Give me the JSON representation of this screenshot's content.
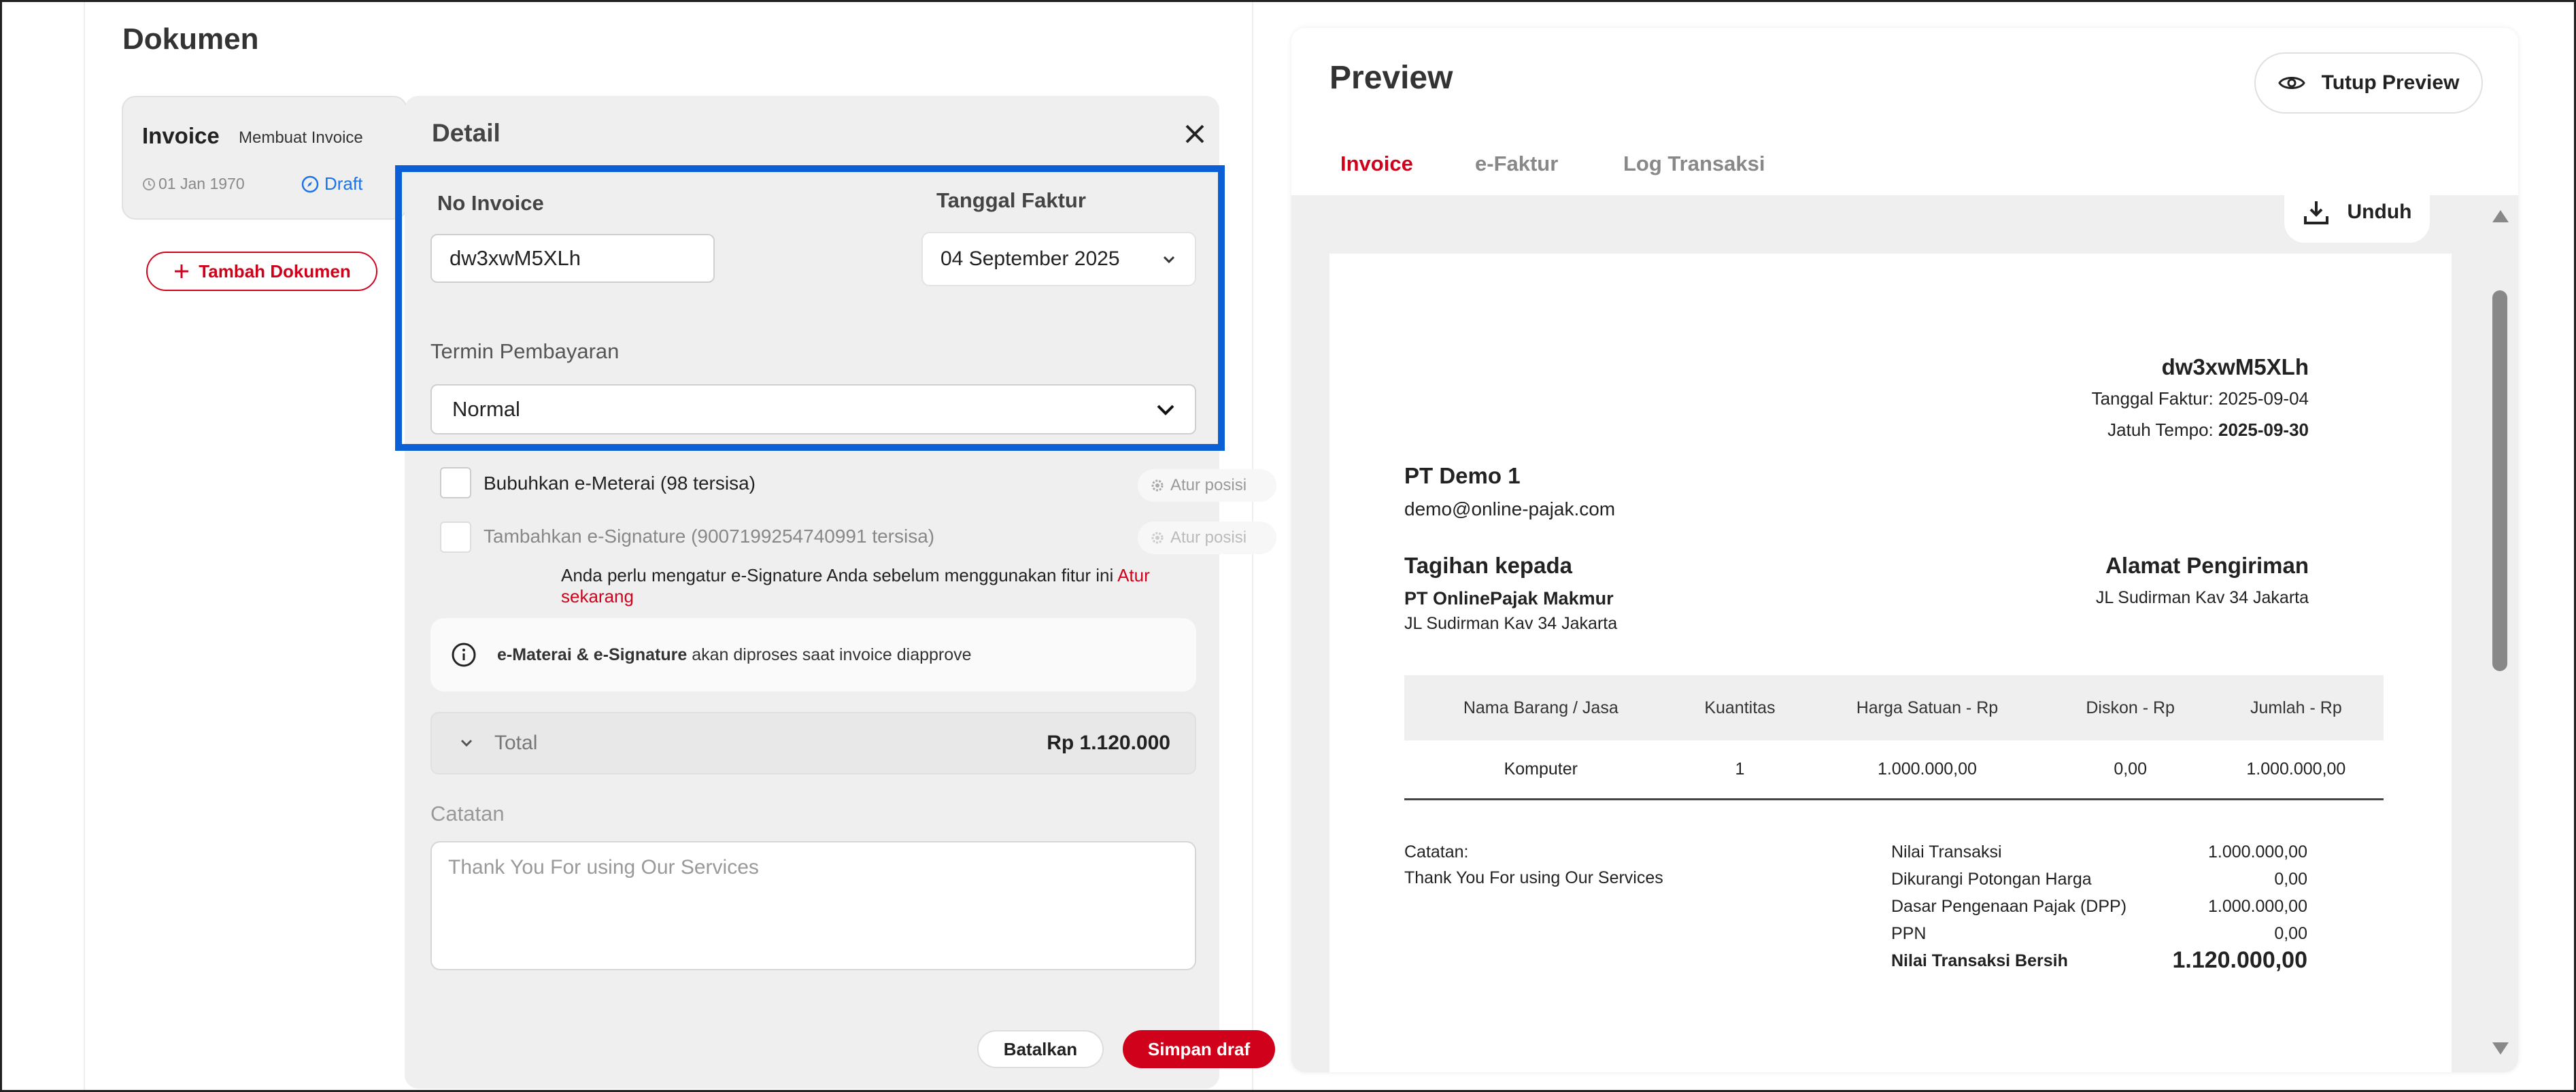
{
  "left": {
    "title": "Dokumen",
    "card": {
      "title": "Invoice",
      "subtitle": "Membuat Invoice",
      "date": "01 Jan 1970",
      "status": "Draft"
    },
    "add_button": "Tambah Dokumen"
  },
  "detail": {
    "title": "Detail",
    "no_invoice_label": "No Invoice",
    "no_invoice_value": "dw3xwM5XLh",
    "tanggal_label": "Tanggal Faktur",
    "tanggal_value": "04 September 2025",
    "termin_label": "Termin Pembayaran",
    "termin_value": "Normal",
    "meterai_label": "Bubuhkan e-Meterai (98 tersisa)",
    "sign_label": "Tambahkan e-Signature (9007199254740991 tersisa)",
    "atur_posisi": "Atur posisi",
    "sign_note": "Anda perlu mengatur e-Signature Anda sebelum menggunakan fitur ini",
    "sign_note_link": "Atur sekarang",
    "info_bold": "e-Materai & e-Signature",
    "info_rest": "akan diproses saat invoice diapprove",
    "total_label": "Total",
    "total_value": "Rp 1.120.000",
    "catatan_label": "Catatan",
    "catatan_value": "Thank You For using Our Services",
    "cancel_button": "Batalkan",
    "save_button": "Simpan draf"
  },
  "preview": {
    "title": "Preview",
    "close_button": "Tutup Preview",
    "tabs": [
      "Invoice",
      "e-Faktur",
      "Log Transaksi"
    ],
    "active_tab": "Invoice",
    "download_button": "Unduh",
    "invoice": {
      "number": "dw3xwM5XLh",
      "tanggal": "Tanggal Faktur: 2025-09-04",
      "jatuh_tempo_label": "Jatuh Tempo:",
      "jatuh_tempo_value": "2025-09-30",
      "from_name": "PT Demo 1",
      "from_email": "demo@online-pajak.com",
      "bill_heading": "Tagihan kepada",
      "bill_name": "PT OnlinePajak Makmur",
      "bill_address": "JL Sudirman Kav 34 Jakarta",
      "ship_heading": "Alamat Pengiriman",
      "ship_address": "JL Sudirman Kav 34 Jakarta",
      "table": {
        "headers": [
          "Nama Barang / Jasa",
          "Kuantitas",
          "Harga Satuan - Rp",
          "Diskon - Rp",
          "Jumlah - Rp"
        ],
        "rows": [
          [
            "Komputer",
            "1",
            "1.000.000,00",
            "0,00",
            "1.000.000,00"
          ]
        ]
      },
      "notes_label": "Catatan:",
      "notes_value": "Thank You For using Our Services",
      "summary": [
        {
          "label": "Nilai Transaksi",
          "value": "1.000.000,00"
        },
        {
          "label": "Dikurangi Potongan Harga",
          "value": "0,00"
        },
        {
          "label": "Dasar Pengenaan Pajak (DPP)",
          "value": "1.000.000,00"
        },
        {
          "label": "PPN",
          "value": "0,00"
        },
        {
          "label": "Nilai Transaksi Bersih",
          "value": "1.120.000,00"
        }
      ]
    }
  },
  "colors": {
    "accent": "#d0021b",
    "highlight": "#0a5fd6",
    "draft": "#1a73e8"
  }
}
